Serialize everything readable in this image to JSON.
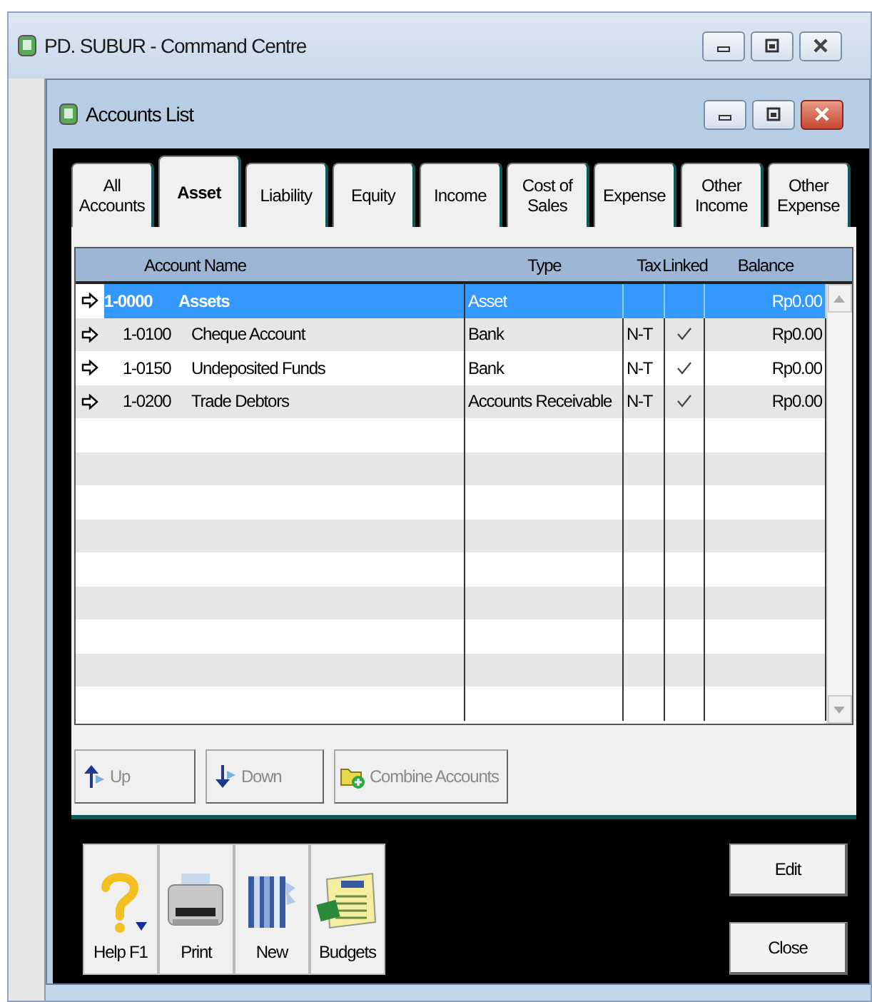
{
  "outer_window": {
    "title": "PD. SUBUR - Command Centre"
  },
  "window": {
    "title": "Accounts List"
  },
  "tabs": [
    {
      "label": "All Accounts",
      "selected": false
    },
    {
      "label": "Asset",
      "selected": true
    },
    {
      "label": "Liability",
      "selected": false
    },
    {
      "label": "Equity",
      "selected": false
    },
    {
      "label": "Income",
      "selected": false
    },
    {
      "label": "Cost of Sales",
      "selected": false
    },
    {
      "label": "Expense",
      "selected": false
    },
    {
      "label": "Other Income",
      "selected": false
    },
    {
      "label": "Other Expense",
      "selected": false
    }
  ],
  "table": {
    "columns": [
      "Account Name",
      "Type",
      "Tax",
      "Linked",
      "Balance"
    ],
    "rows": [
      {
        "kind": "header",
        "number": "1-0000",
        "name": "Assets",
        "type": "Asset",
        "balance": "Rp0.00",
        "linked": false,
        "selected": true
      },
      {
        "kind": "detail",
        "number": "1-0100",
        "name": "Cheque Account",
        "type": "Bank",
        "tax": "N-T",
        "linked": true,
        "balance": "Rp0.00",
        "selected": false
      },
      {
        "kind": "detail",
        "number": "1-0150",
        "name": "Undeposited Funds",
        "type": "Bank",
        "tax": "N-T",
        "linked": true,
        "balance": "Rp0.00",
        "selected": false
      },
      {
        "kind": "detail",
        "number": "1-0200",
        "name": "Trade Debtors",
        "type": "Accounts Receivable",
        "tax": "N-T",
        "linked": true,
        "balance": "Rp0.00",
        "selected": false
      }
    ]
  },
  "list_buttons": [
    {
      "kind": "up",
      "label": "Up",
      "disabled": true
    },
    {
      "kind": "down",
      "label": "Down",
      "disabled": true
    },
    {
      "kind": "combine",
      "label": "Combine Accounts",
      "disabled": true
    }
  ],
  "toolbar": [
    {
      "kind": "help",
      "label": "Help F1"
    },
    {
      "kind": "print",
      "label": "Print"
    },
    {
      "kind": "new",
      "label": "New"
    },
    {
      "kind": "budgets",
      "label": "Budgets"
    }
  ],
  "buttons": [
    "Edit",
    "Close"
  ]
}
